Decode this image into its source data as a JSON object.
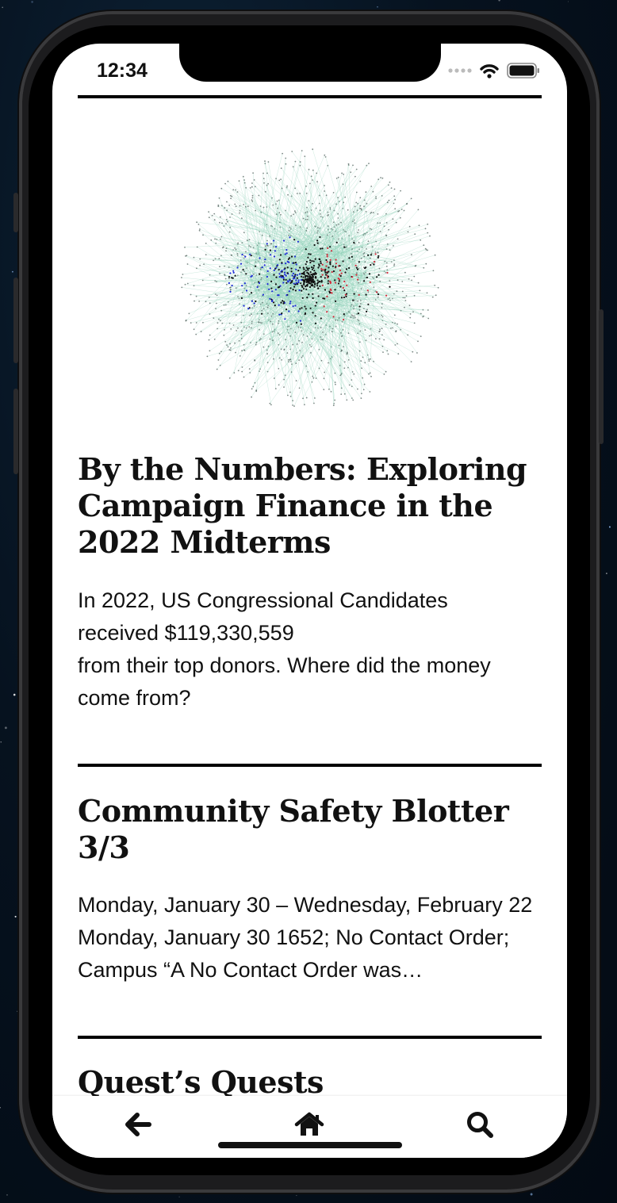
{
  "status_bar": {
    "time": "12:34"
  },
  "articles": [
    {
      "headline": "By the Numbers: Exploring Campaign Finance in the 2022 Midterms",
      "summary_lines": [
        "In 2022, US Congressional Candidates",
        "received $119,330,559",
        "from their top donors. Where did the money come from?"
      ]
    },
    {
      "headline": "Community Safety Blotter 3/3",
      "summary": "Monday, January 30 – Wednesday, February 22 Monday, January 30 1652; No Contact Order; Campus “A No Contact Order was…"
    },
    {
      "headline": "Quest’s Quests"
    }
  ],
  "nav": {
    "back_icon": "arrow-left-icon",
    "home_icon": "home-icon",
    "search_icon": "search-icon"
  },
  "colors": {
    "network_edges": "#8fd1b8",
    "network_blue": "#1d2bd6",
    "network_red": "#d42a3a",
    "network_black": "#111111"
  }
}
